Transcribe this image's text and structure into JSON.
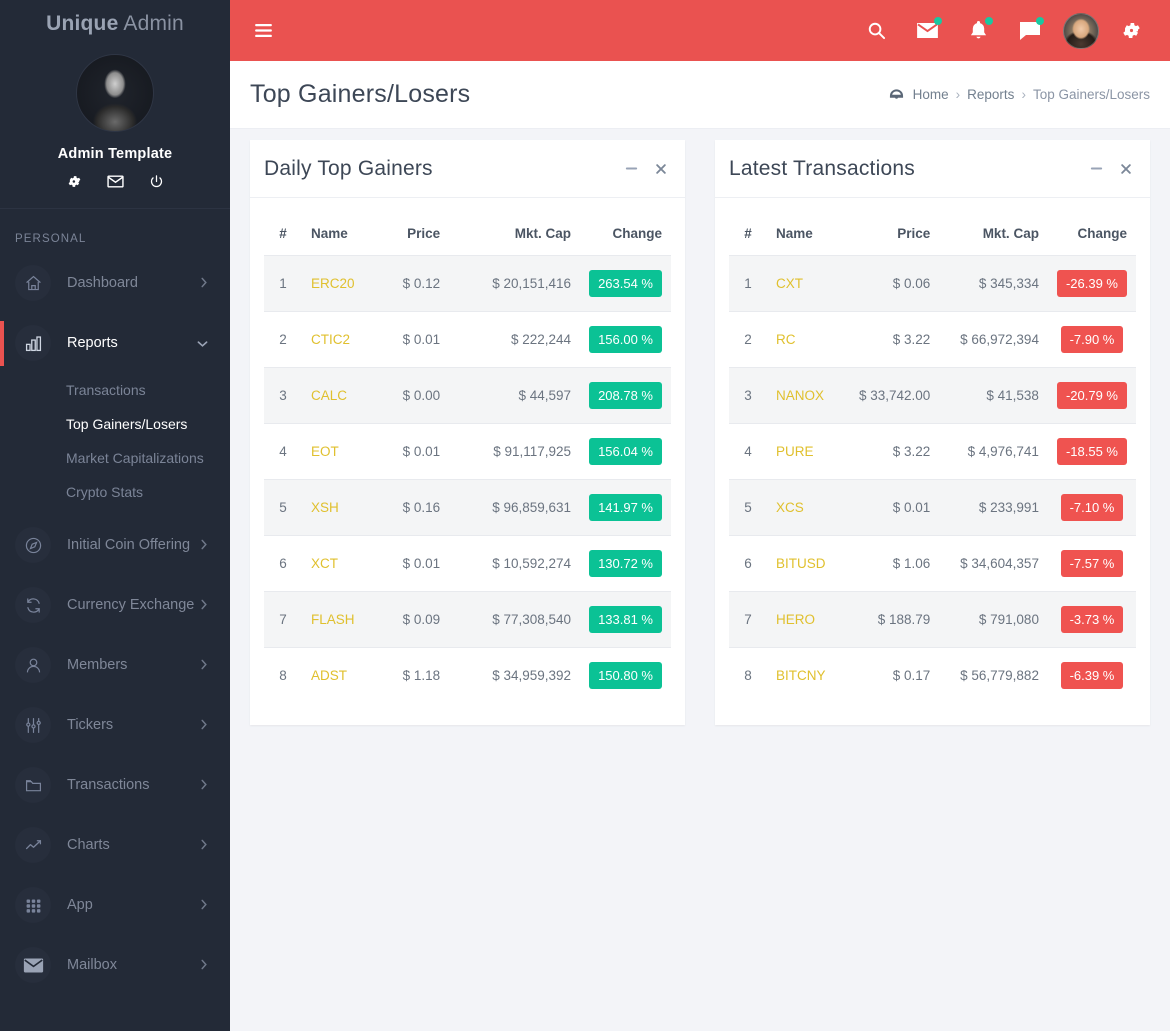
{
  "sidebar": {
    "brand_strong": "Unique",
    "brand_light": "Admin",
    "profile_name": "Admin Template",
    "profile_actions": [
      {
        "name": "settings-icon",
        "label": "Settings"
      },
      {
        "name": "mail-icon",
        "label": "Messages"
      },
      {
        "name": "power-icon",
        "label": "Logout"
      }
    ],
    "section_label": "PERSONAL",
    "items": [
      {
        "label": "Dashboard",
        "icon": "home-icon",
        "caret": "›",
        "active": false
      },
      {
        "label": "Reports",
        "icon": "bar-chart-icon",
        "caret": "⌄",
        "active": true
      },
      {
        "label": "Initial Coin Offering",
        "icon": "compass-icon",
        "caret": "›",
        "active": false
      },
      {
        "label": "Currency Exchange",
        "icon": "refresh-icon",
        "caret": "›",
        "active": false
      },
      {
        "label": "Members",
        "icon": "user-icon",
        "caret": "›",
        "active": false
      },
      {
        "label": "Tickers",
        "icon": "sliders-icon",
        "caret": "›",
        "active": false
      },
      {
        "label": "Transactions",
        "icon": "folder-icon",
        "caret": "›",
        "active": false
      },
      {
        "label": "Charts",
        "icon": "line-chart-icon",
        "caret": "›",
        "active": false
      },
      {
        "label": "App",
        "icon": "grid-icon",
        "caret": "›",
        "active": false
      },
      {
        "label": "Mailbox",
        "icon": "envelope-filled-icon",
        "caret": "›",
        "active": false
      }
    ],
    "reports_submenu": [
      {
        "label": "Transactions",
        "active": false
      },
      {
        "label": "Top Gainers/Losers",
        "active": true
      },
      {
        "label": "Market Capitalizations",
        "active": false
      },
      {
        "label": "Crypto Stats",
        "active": false
      }
    ]
  },
  "topbar": {
    "menu_toggle": "hamburger-icon",
    "actions": [
      {
        "name": "search-icon",
        "badge": false
      },
      {
        "name": "mail-icon",
        "badge": true
      },
      {
        "name": "bell-icon",
        "badge": true
      },
      {
        "name": "chat-icon",
        "badge": true
      },
      {
        "name": "avatar",
        "badge": false
      },
      {
        "name": "gear-icon",
        "badge": false
      }
    ]
  },
  "page": {
    "title": "Top Gainers/Losers",
    "breadcrumb": {
      "icon": "dashboard-icon",
      "home": "Home",
      "sep": "›",
      "section": "Reports",
      "current": "Top Gainers/Losers"
    }
  },
  "colors": {
    "header_red": "#ea5250",
    "sidebar_dark": "#232a37",
    "accent_green": "#0bc295",
    "accent_red": "#ef5350",
    "asset_gold": "#e0c02e",
    "page_bg": "#f3f4f8"
  },
  "cards": {
    "gainers": {
      "title": "Daily Top Gainers",
      "minimize": "−",
      "close": "×",
      "columns": [
        "#",
        "Name",
        "Price",
        "Mkt. Cap",
        "Change"
      ],
      "rows": [
        {
          "num": "1",
          "name": "ERC20",
          "price": "$ 0.12",
          "cap": "$ 20,151,416",
          "change": "263.54 %",
          "dir": "up"
        },
        {
          "num": "2",
          "name": "CTIC2",
          "price": "$ 0.01",
          "cap": "$ 222,244",
          "change": "156.00 %",
          "dir": "up"
        },
        {
          "num": "3",
          "name": "CALC",
          "price": "$ 0.00",
          "cap": "$ 44,597",
          "change": "208.78 %",
          "dir": "up"
        },
        {
          "num": "4",
          "name": "EOT",
          "price": "$ 0.01",
          "cap": "$ 91,117,925",
          "change": "156.04 %",
          "dir": "up"
        },
        {
          "num": "5",
          "name": "XSH",
          "price": "$ 0.16",
          "cap": "$ 96,859,631",
          "change": "141.97 %",
          "dir": "up"
        },
        {
          "num": "6",
          "name": "XCT",
          "price": "$ 0.01",
          "cap": "$ 10,592,274",
          "change": "130.72 %",
          "dir": "up"
        },
        {
          "num": "7",
          "name": "FLASH",
          "price": "$ 0.09",
          "cap": "$ 77,308,540",
          "change": "133.81 %",
          "dir": "up"
        },
        {
          "num": "8",
          "name": "ADST",
          "price": "$ 1.18",
          "cap": "$ 34,959,392",
          "change": "150.80 %",
          "dir": "up"
        }
      ]
    },
    "transactions": {
      "title": "Latest Transactions",
      "minimize": "−",
      "close": "×",
      "columns": [
        "#",
        "Name",
        "Price",
        "Mkt. Cap",
        "Change"
      ],
      "rows": [
        {
          "num": "1",
          "name": "CXT",
          "price": "$ 0.06",
          "cap": "$ 345,334",
          "change": "-26.39 %",
          "dir": "down"
        },
        {
          "num": "2",
          "name": "RC",
          "price": "$ 3.22",
          "cap": "$ 66,972,394",
          "change": "-7.90 %",
          "dir": "down"
        },
        {
          "num": "3",
          "name": "NANOX",
          "price": "$ 33,742.00",
          "cap": "$ 41,538",
          "change": "-20.79 %",
          "dir": "down"
        },
        {
          "num": "4",
          "name": "PURE",
          "price": "$ 3.22",
          "cap": "$ 4,976,741",
          "change": "-18.55 %",
          "dir": "down"
        },
        {
          "num": "5",
          "name": "XCS",
          "price": "$ 0.01",
          "cap": "$ 233,991",
          "change": "-7.10 %",
          "dir": "down"
        },
        {
          "num": "6",
          "name": "BITUSD",
          "price": "$ 1.06",
          "cap": "$ 34,604,357",
          "change": "-7.57 %",
          "dir": "down"
        },
        {
          "num": "7",
          "name": "HERO",
          "price": "$ 188.79",
          "cap": "$ 791,080",
          "change": "-3.73 %",
          "dir": "down"
        },
        {
          "num": "8",
          "name": "BITCNY",
          "price": "$ 0.17",
          "cap": "$ 56,779,882",
          "change": "-6.39 %",
          "dir": "down"
        }
      ]
    }
  }
}
